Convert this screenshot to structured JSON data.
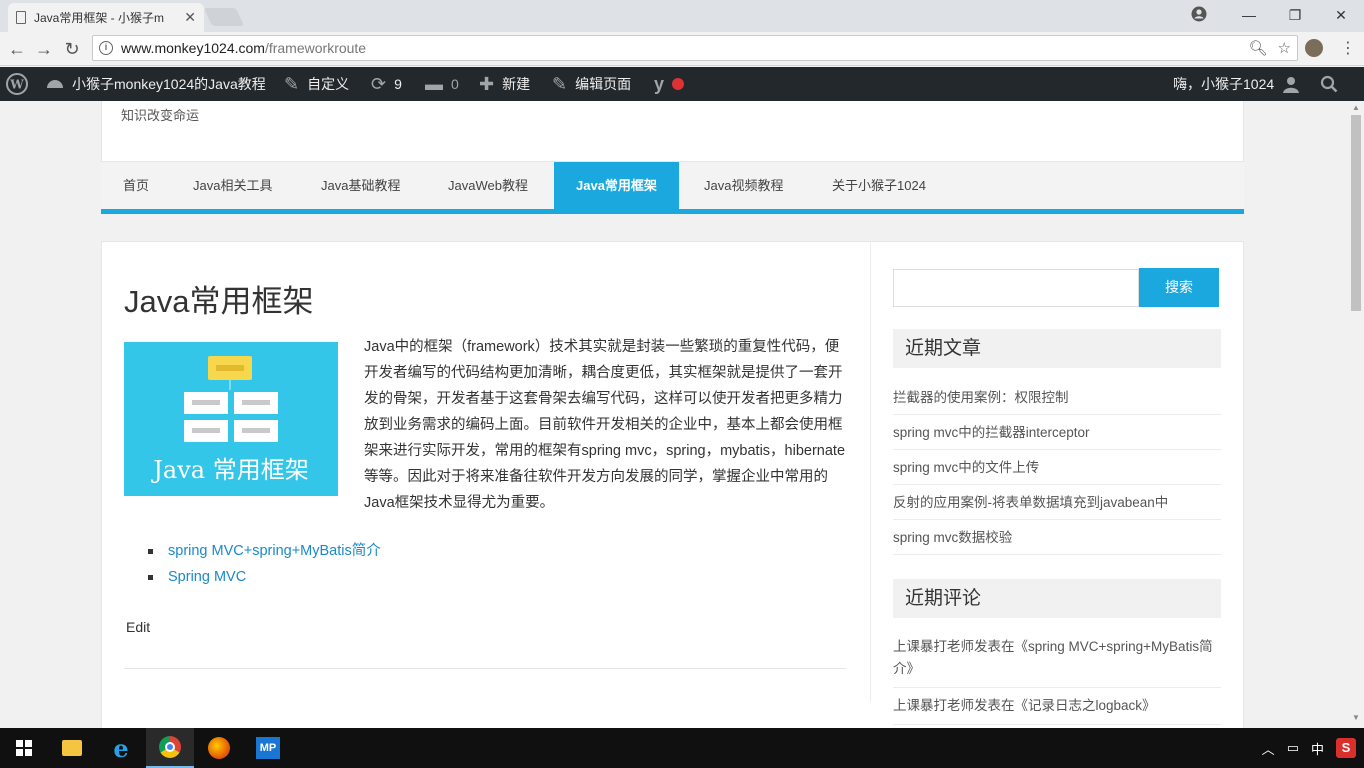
{
  "browser": {
    "tab_title": "Java常用框架 - 小猴子m",
    "tab_close": "✕",
    "url_host": "www.monkey1024.com",
    "url_path": "/frameworkroute",
    "win_min": "—",
    "win_restore": "❐",
    "win_close": "✕"
  },
  "adminbar": {
    "site_name": "小猴子monkey1024的Java教程",
    "customize": "自定义",
    "updates_count": "9",
    "comments_count": "0",
    "new_label": "新建",
    "edit_page": "编辑页面",
    "greeting": "嗨，小猴子1024"
  },
  "site": {
    "tagline": "知识改变命运"
  },
  "nav": {
    "items": [
      "首页",
      "Java相关工具",
      "Java基础教程",
      "JavaWeb教程",
      "Java常用框架",
      "Java视频教程",
      "关于小猴子1024"
    ],
    "active_index": 4
  },
  "post": {
    "title": "Java常用框架",
    "image_text": "Java 常用框架",
    "body": "Java中的框架（framework）技术其实就是封装一些繁琐的重复性代码，便开发者编写的代码结构更加清晰，耦合度更低，其实框架就是提供了一套开发的骨架，开发者基于这套骨架去编写代码，这样可以使开发者把更多精力放到业务需求的编码上面。目前软件开发相关的企业中，基本上都会使用框架来进行实际开发，常用的框架有spring mvc，spring，mybatis，hibernate等等。因此对于将来准备往软件开发方向发展的同学，掌握企业中常用的Java框架技术显得尤为重要。",
    "links": [
      "spring MVC+spring+MyBatis简介",
      "Spring MVC"
    ],
    "edit_label": "Edit"
  },
  "sidebar": {
    "search_button": "搜索",
    "search_value": "",
    "recent_posts_title": "近期文章",
    "recent_posts": [
      "拦截器的使用案例：权限控制",
      "spring mvc中的拦截器interceptor",
      "spring mvc中的文件上传",
      "反射的应用案例-将表单数据填充到javabean中",
      "spring mvc数据校验"
    ],
    "recent_comments_title": "近期评论",
    "recent_comments": [
      "上课暴打老师发表在《spring MVC+spring+MyBatis简介》",
      "上课暴打老师发表在《记录日志之logback》"
    ]
  },
  "taskbar": {
    "mp_label": "MP",
    "ime": "中",
    "s_label": "S"
  },
  "colors": {
    "accent": "#1aa8df",
    "adminbar": "#23282d",
    "link": "#1a8ac9"
  }
}
